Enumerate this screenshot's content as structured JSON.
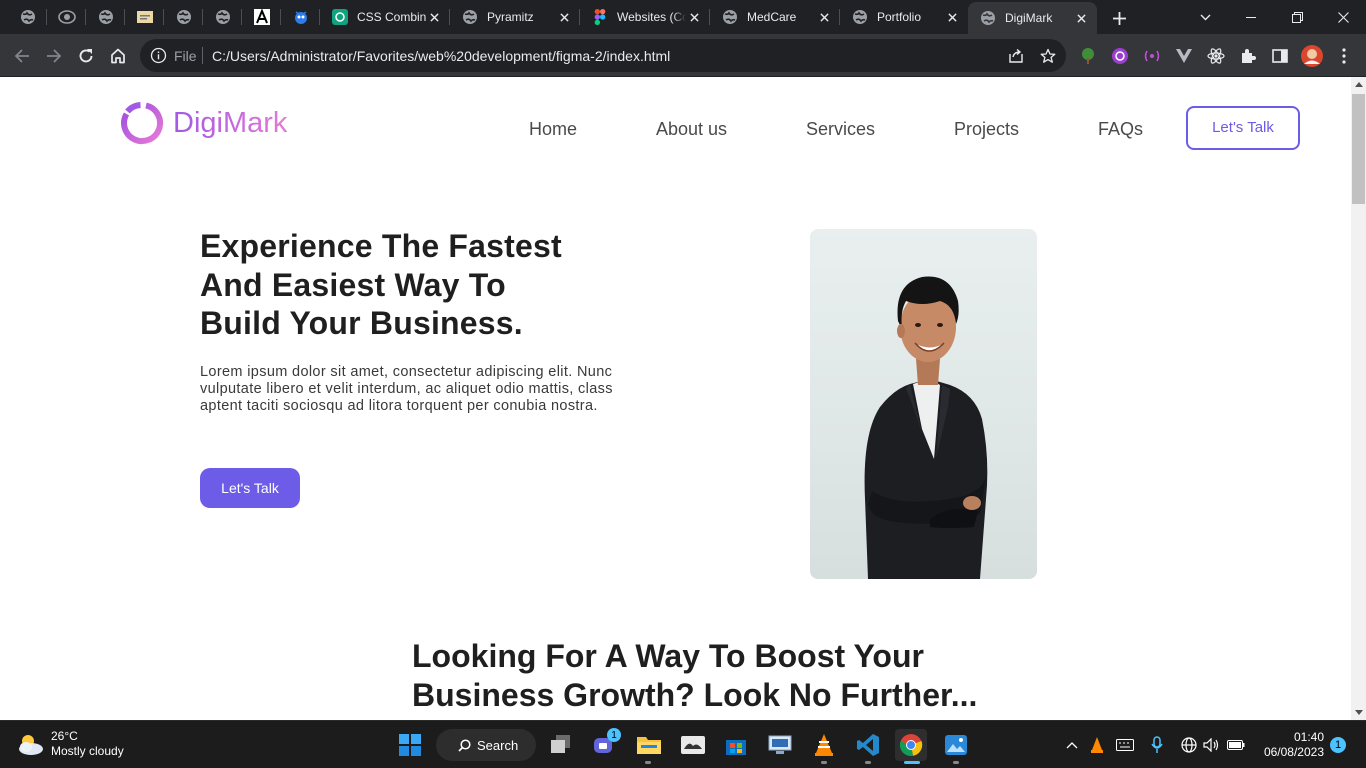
{
  "browser": {
    "pinned_tabs": [
      {
        "icon": "globe-icon"
      },
      {
        "icon": "eye-icon"
      },
      {
        "icon": "globe-icon"
      },
      {
        "icon": "mail-icon"
      },
      {
        "icon": "globe-icon"
      },
      {
        "icon": "globe-icon"
      },
      {
        "icon": "font-a-icon"
      },
      {
        "icon": "bot-icon"
      }
    ],
    "tabs": [
      {
        "title": "CSS Combinators",
        "icon": "chatgpt-icon",
        "active": false
      },
      {
        "title": "Pyramitz",
        "icon": "globe-icon",
        "active": false
      },
      {
        "title": "Websites (Community)",
        "icon": "figma-icon",
        "active": false
      },
      {
        "title": "MedCare",
        "icon": "globe-icon",
        "active": false
      },
      {
        "title": "Portfolio",
        "icon": "globe-icon",
        "active": false
      },
      {
        "title": "DigiMark",
        "icon": "globe-icon",
        "active": true
      }
    ],
    "address": {
      "scheme_label": "File",
      "url": "C:/Users/Administrator/Favorites/web%20development/figma-2/index.html"
    },
    "colors": {
      "tabbar": "#202124",
      "toolbar": "#35363a",
      "omnibox": "#202124"
    }
  },
  "page": {
    "logo_text": "DigiMark",
    "nav": [
      "Home",
      "About us",
      "Services",
      "Projects",
      "FAQs"
    ],
    "header_cta": "Let's Talk",
    "hero": {
      "title_lines": [
        "Experience The Fastest",
        "And Easiest Way To",
        "Build Your Business."
      ],
      "text_lines": [
        "Lorem ipsum dolor sit amet, consectetur adipiscing elit. Nunc",
        "vulputate libero et velit interdum, ac aliquet odio mattis, class",
        "aptent taciti sociosqu ad litora torquent per conubia nostra."
      ],
      "cta": "Let's Talk",
      "photo": "smiling-man-in-black-suit-arms-crossed"
    },
    "section2": {
      "title_lines": [
        "Looking For A Way To Boost Your",
        "Business Growth? Look No Further..."
      ]
    },
    "colors": {
      "accent": "#6c5ce7",
      "logo_gradient_start": "#a259e4",
      "logo_gradient_end": "#e479d8",
      "text": "#1f1f1f"
    }
  },
  "taskbar": {
    "weather": {
      "temp": "26°C",
      "condition": "Mostly cloudy"
    },
    "search_label": "Search",
    "apps": [
      "windows-start-icon",
      "search-icon",
      "task-view-icon",
      "teams-chat-icon",
      "file-explorer-icon",
      "photo-app-icon",
      "microsoft-store-icon",
      "remote-desktop-icon",
      "vlc-icon",
      "vscode-icon",
      "chrome-icon",
      "photos-icon"
    ],
    "chat_badge": "1",
    "clock": {
      "time": "01:40",
      "date": "06/08/2023"
    },
    "notification_count": "1"
  }
}
